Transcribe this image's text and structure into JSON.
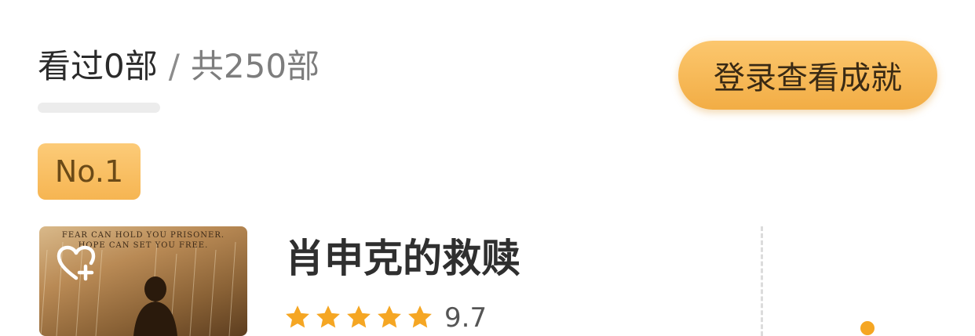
{
  "progress": {
    "seen_label": "看过0部",
    "separator": "/",
    "total_label": "共250部",
    "seen_fraction": 0
  },
  "login_button": {
    "label": "登录查看成就"
  },
  "item": {
    "rank_label": "No.1",
    "poster": {
      "line1": "FEAR CAN HOLD YOU PRISONER.",
      "line2": "HOPE CAN SET YOU FREE."
    },
    "title": "肖申克的救赎",
    "rating_stars": 5,
    "score": "9.7"
  },
  "icons": {
    "favorite": "heart-plus-icon",
    "star": "star-icon"
  },
  "colors": {
    "accent": "#f5b24a",
    "star": "#f5a623",
    "badge_text": "#6b4a17",
    "button_text": "#3a2a14"
  }
}
